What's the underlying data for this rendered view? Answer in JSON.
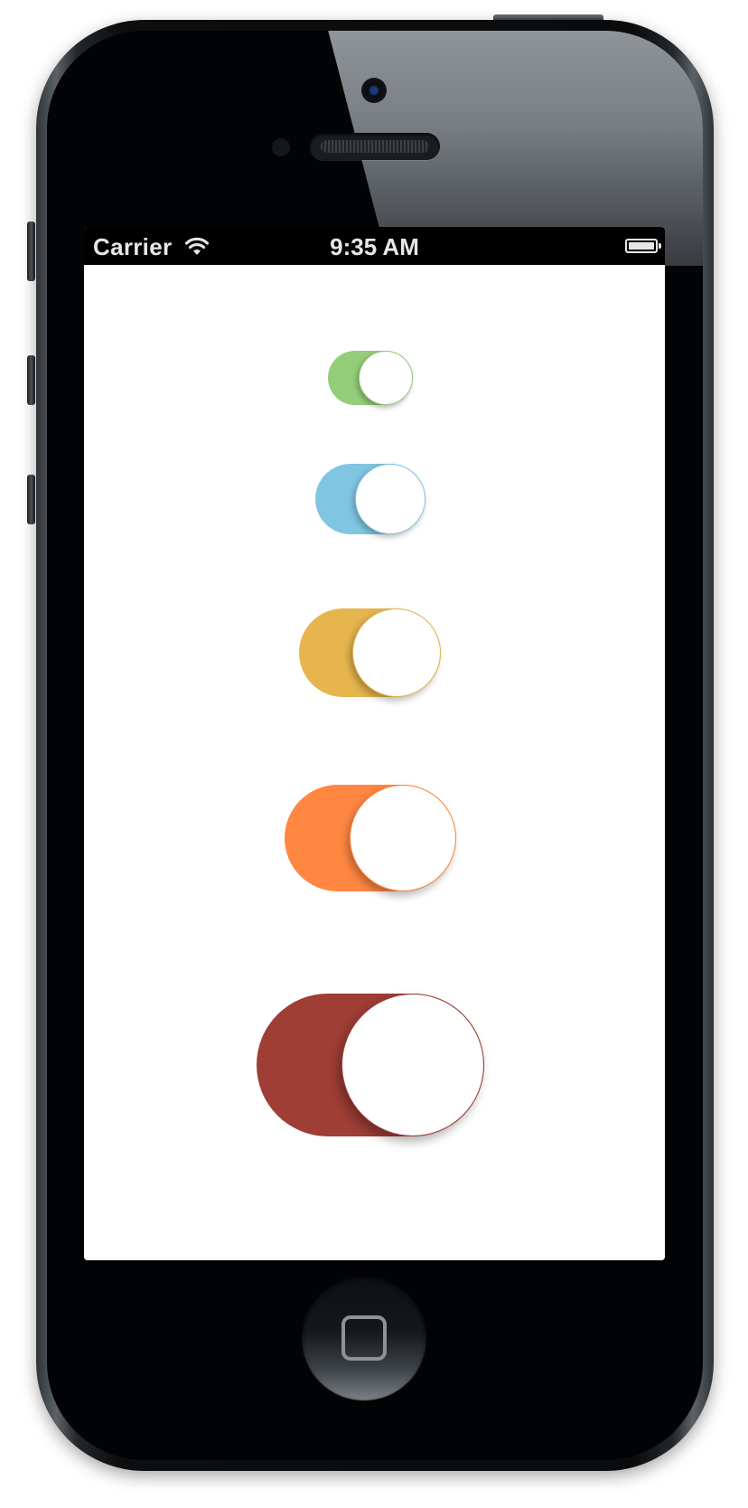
{
  "device": {
    "model": "iPhone"
  },
  "status_bar": {
    "carrier": "Carrier",
    "time": "9:35 AM",
    "wifi_icon": "wifi-icon",
    "battery_icon": "battery-icon"
  },
  "switches": [
    {
      "name": "green",
      "state": "on",
      "color": "#93cd7a"
    },
    {
      "name": "blue",
      "state": "on",
      "color": "#80c5e2"
    },
    {
      "name": "yellow",
      "state": "on",
      "color": "#e6b54e"
    },
    {
      "name": "orange",
      "state": "on",
      "color": "#ff8742"
    },
    {
      "name": "red",
      "state": "on",
      "color": "#9e3e35"
    }
  ],
  "home_button": {
    "icon": "home-square-icon"
  }
}
